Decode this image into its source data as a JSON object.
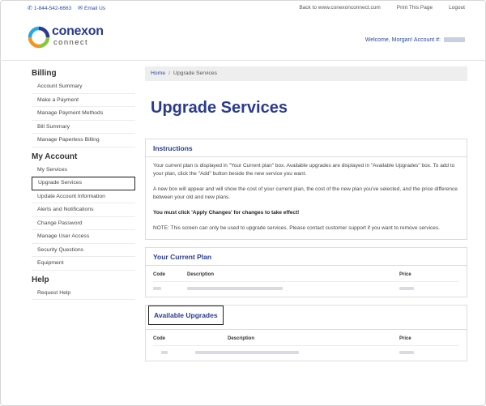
{
  "topbar": {
    "phone": "1-844-542-6663",
    "email": "Email Us",
    "links": [
      "Back to www.conexonconnect.com",
      "Print This Page",
      "Logout"
    ]
  },
  "header": {
    "logo_line1": "conexon",
    "logo_line2": "connect",
    "welcome": "Welcome, Morgan! Account #:"
  },
  "sidebar": {
    "billing_title": "Billing",
    "billing_items": [
      "Account Summary",
      "Make a Payment",
      "Manage Payment Methods",
      "Bill Summary",
      "Manage Paperless Billing"
    ],
    "account_title": "My Account",
    "account_items": [
      "My Services",
      "Upgrade Services",
      "Update Account Information",
      "Alerts and Notifications",
      "Change Password",
      "Manage User Access",
      "Security Questions",
      "Equipment"
    ],
    "help_title": "Help",
    "help_items": [
      "Request Help"
    ]
  },
  "breadcrumb": {
    "home": "Home",
    "current": "Upgrade Services"
  },
  "page_title": "Upgrade Services",
  "instructions": {
    "title": "Instructions",
    "p1": "Your current plan is displayed in \"Your Current plan\" box. Available upgrades are displayed in \"Available Upgrades\" box. To add to your plan, click the \"Add\" button beside the new service you want.",
    "p2": "A new box will appear and will show the cost of your current plan, the cost of the new plan you've selected, and the price difference between your old and new plans.",
    "p3": "You must click 'Apply Changes' for changes to take effect!",
    "p4": "NOTE: This screen can only be used to upgrade services. Please contact customer support if you want to remove services."
  },
  "current_plan": {
    "title": "Your Current Plan",
    "headers": [
      "Code",
      "Description",
      "Price"
    ]
  },
  "available_upgrades": {
    "title": "Available Upgrades",
    "headers": [
      "Code",
      "Description",
      "Price"
    ]
  },
  "colors": {
    "brand": "#2a3b8f",
    "link": "#2a4aa8"
  }
}
